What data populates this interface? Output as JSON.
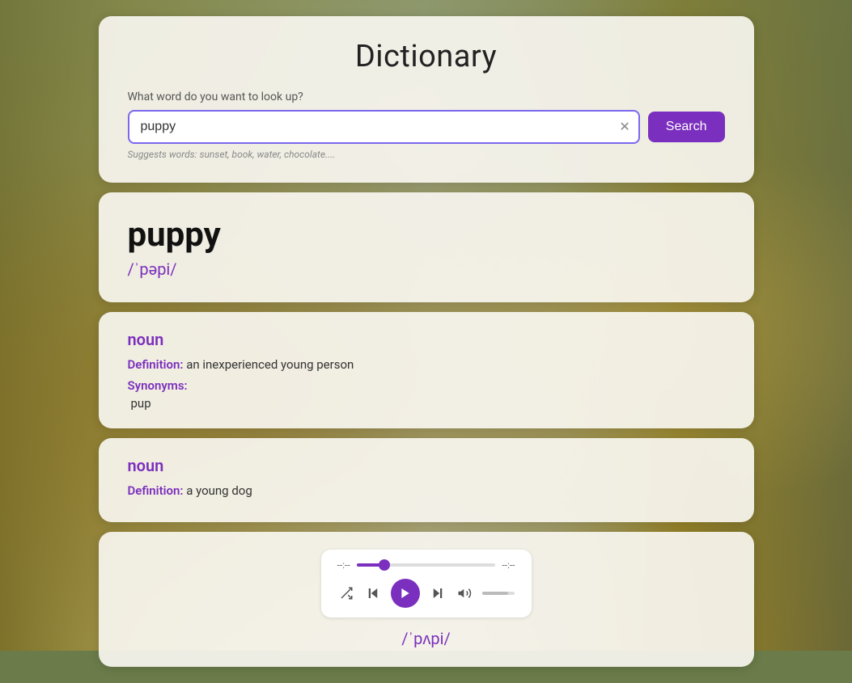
{
  "background": {
    "description": "dogs background"
  },
  "app": {
    "title": "Dictionary"
  },
  "search": {
    "label": "What word do you want to look up?",
    "input_value": "puppy",
    "hint": "Suggests words: sunset, book, water, chocolate....",
    "button_label": "Search"
  },
  "word": {
    "text": "puppy",
    "phonetic": "/ˈpəpi/"
  },
  "definitions": [
    {
      "part_of_speech": "noun",
      "definition_label": "Definition:",
      "definition": "an inexperienced young person",
      "synonyms_label": "Synonyms:",
      "synonyms": [
        "pup"
      ]
    },
    {
      "part_of_speech": "noun",
      "definition_label": "Definition:",
      "definition": "a young dog",
      "synonyms_label": null,
      "synonyms": []
    }
  ],
  "audio": {
    "time_current": "--:--",
    "time_total": "--:--",
    "phonetic": "/ˈpʌpi/"
  },
  "colors": {
    "accent": "#7b2fbe",
    "accent_light": "#7b68ee"
  }
}
